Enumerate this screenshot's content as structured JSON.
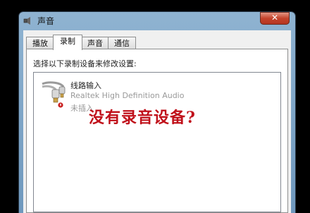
{
  "window": {
    "title": "声音",
    "close_symbol": "✕"
  },
  "tabs": [
    {
      "label": "播放",
      "active": false
    },
    {
      "label": "录制",
      "active": true
    },
    {
      "label": "声音",
      "active": false
    },
    {
      "label": "通信",
      "active": false
    }
  ],
  "panel": {
    "instruction": "选择以下录制设备来修改设置:"
  },
  "devices": [
    {
      "icon": "line-in-cable-icon",
      "name": "线路输入",
      "driver": "Realtek High Definition Audio",
      "status": "未插入"
    }
  ],
  "overlay_text": "没有录音设备?",
  "colors": {
    "overlay": "#c0101a",
    "title_bar": "#8fb3d1",
    "close_button": "#c4432b"
  }
}
